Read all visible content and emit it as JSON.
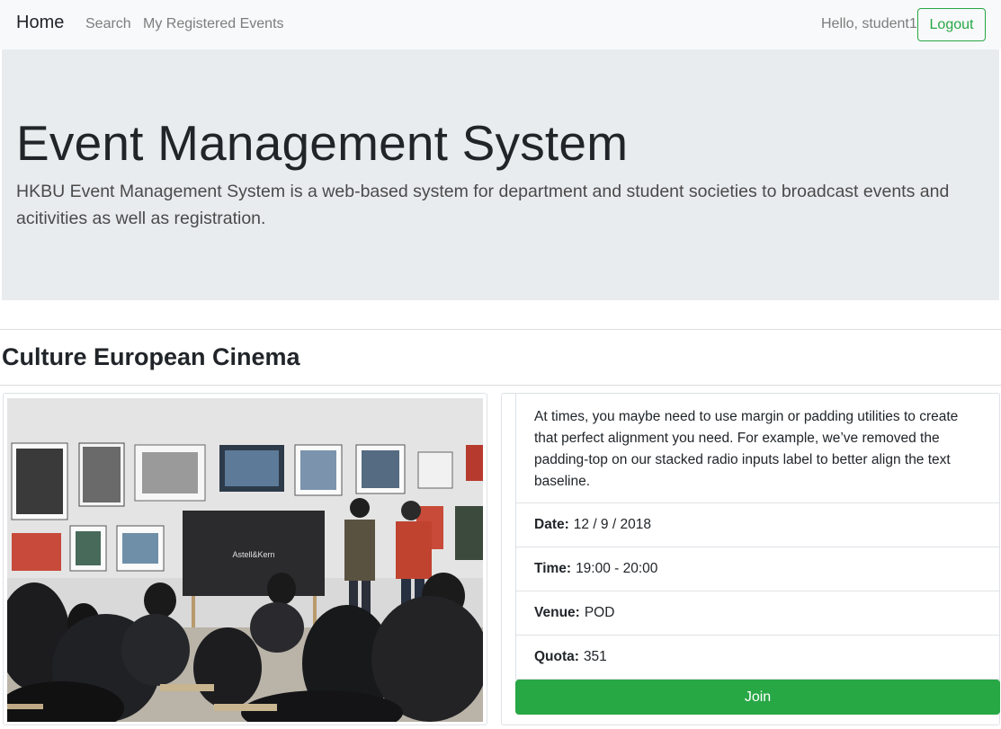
{
  "navbar": {
    "brand": "Home",
    "links": [
      "Search",
      "My Registered Events"
    ],
    "greeting": "Hello, student1",
    "logout_label": "Logout"
  },
  "jumbotron": {
    "title": "Event Management System",
    "lead": "HKBU Event Management System is a web-based system for department and student societies to broadcast events and acitivities as well as registration."
  },
  "event": {
    "title": "Culture European Cinema",
    "description": "At times, you maybe need to use margin or padding utilities to create that perfect alignment you need. For example, we’ve removed the padding-top on our stacked radio inputs label to better align the text baseline.",
    "date_label": "Date:",
    "date": "12 / 9 / 2018",
    "time_label": "Time:",
    "time": "19:00 - 20:00",
    "venue_label": "Venue:",
    "venue": "POD",
    "quota_label": "Quota:",
    "quota": "351",
    "join_label": "Join",
    "photo_caption": "Astell&Kern"
  },
  "colors": {
    "success": "#28a745",
    "jumbotron_bg": "#e9ecef",
    "navbar_bg": "#f8f9fa"
  }
}
